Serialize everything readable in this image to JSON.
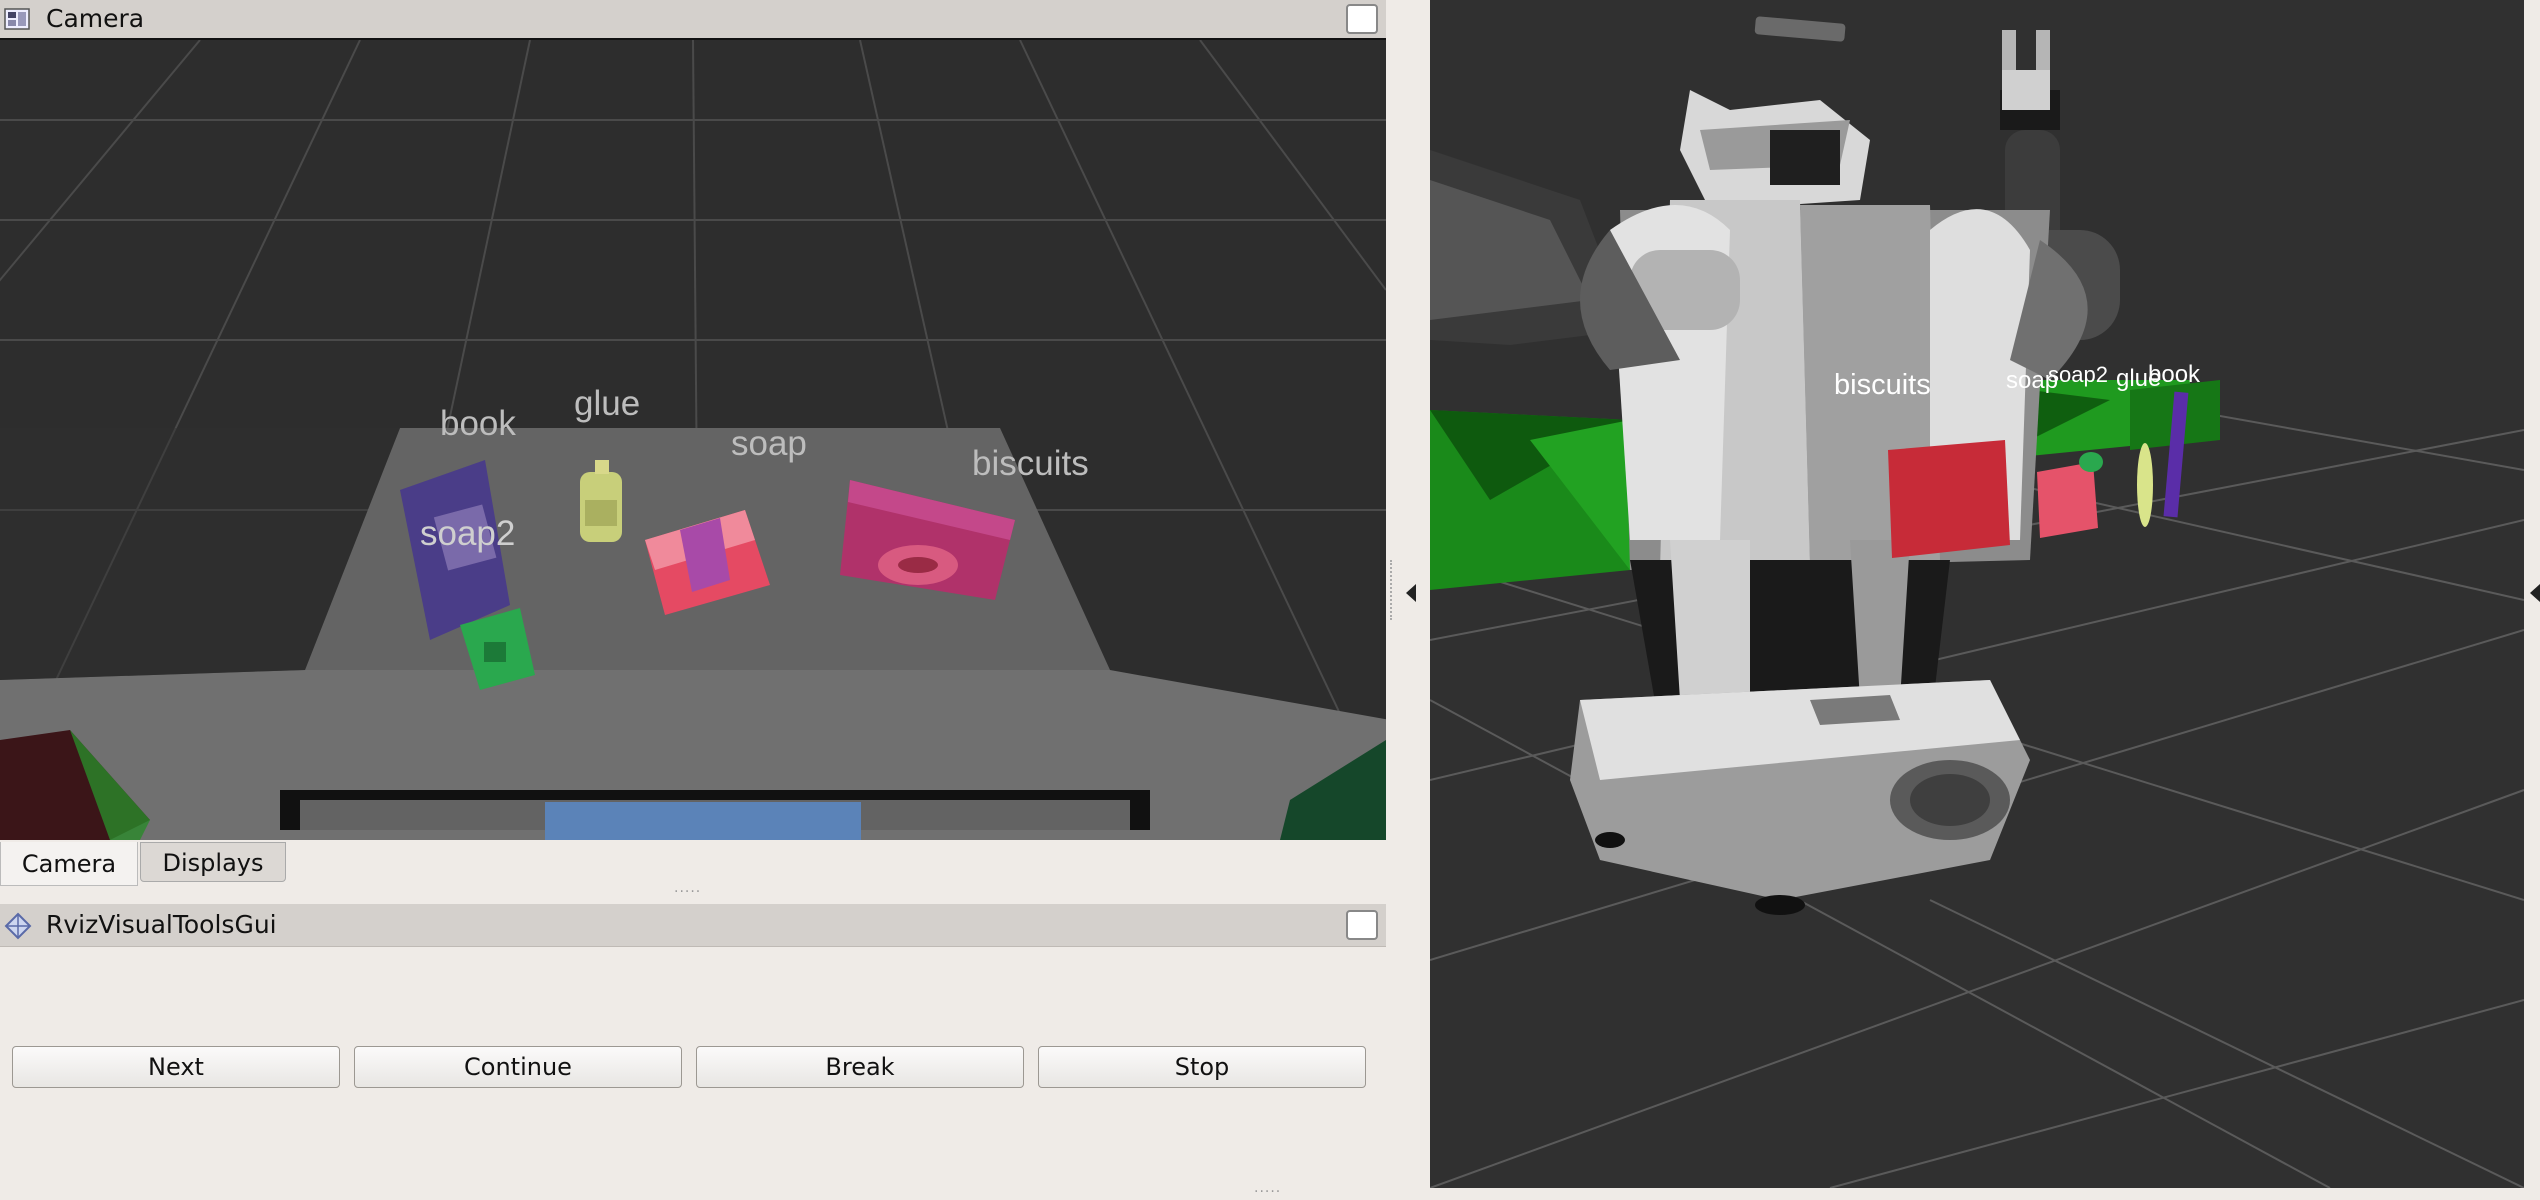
{
  "camera_panel": {
    "title": "Camera",
    "labels": {
      "book": "book",
      "glue": "glue",
      "soap": "soap",
      "soap2": "soap2",
      "biscuits": "biscuits"
    }
  },
  "tabs": [
    {
      "label": "Camera",
      "active": true
    },
    {
      "label": "Displays",
      "active": false
    }
  ],
  "rviz_tools": {
    "title": "RvizVisualToolsGui",
    "buttons": {
      "next": "Next",
      "continue": "Continue",
      "break": "Break",
      "stop": "Stop"
    }
  },
  "main_view": {
    "labels": {
      "biscuits": "biscuits",
      "soap": "soap",
      "soap2": "soap2",
      "glue": "glue",
      "book": "book"
    }
  },
  "colors": {
    "grid_background": "#2b2b2b",
    "biscuits": "#c72b38",
    "soap": "#e5536a",
    "soap2": "#2aa84e",
    "glue": "#d9e48a",
    "book": "#5a2da8",
    "bin": "#1d8a1d"
  },
  "icons": [
    "camera-panel-icon",
    "float-button",
    "rviz-tools-icon",
    "left-arrow-icon"
  ]
}
